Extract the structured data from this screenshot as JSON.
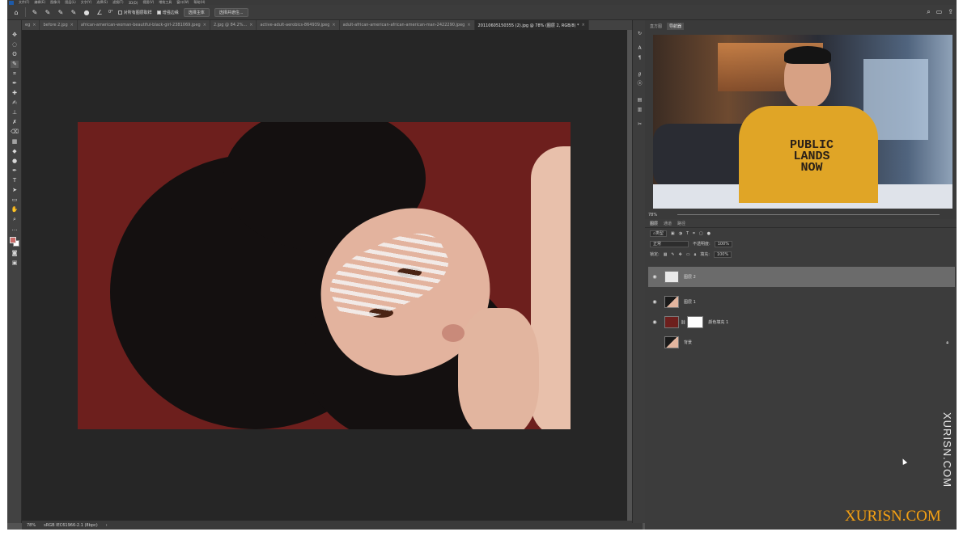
{
  "menubar": {
    "items": [
      "文件(F)",
      "编辑(E)",
      "图像(I)",
      "图层(L)",
      "文字(Y)",
      "选择(S)",
      "滤镜(T)",
      "3D(D)",
      "视图(V)",
      "增效工具",
      "窗口(W)",
      "帮助(H)"
    ]
  },
  "options": {
    "angle": "0°",
    "sample_all_layers": "对所有图层取样",
    "enhance_edge": "增强边缘",
    "select_subject": "选择主体",
    "select_and_mask": "选择并遮住..."
  },
  "tabs": [
    {
      "label": "eg",
      "active": false
    },
    {
      "label": "before 2.jpg",
      "active": false
    },
    {
      "label": "african-american-woman-beautiful-black-girl-2381069.jpeg",
      "active": false
    },
    {
      "label": "2.jpg @ 84.2%...",
      "active": false
    },
    {
      "label": "active-adult-aerobics-864939.jpeg",
      "active": false
    },
    {
      "label": "adult-african-american-african-american-man-2422290.jpeg",
      "active": false
    },
    {
      "label": "20110605150355 (2).jpg @ 78% (图层 2, RGB/8) *",
      "active": true
    }
  ],
  "status": {
    "zoom": "78%",
    "profile": "sRGB IEC61966-2.1 (8bpc)"
  },
  "panel_top": {
    "tabs": [
      "直方图",
      "导航器"
    ],
    "active_tab": "导航器",
    "zoom": "78%"
  },
  "webcam": {
    "shirt_text_1": "PUBLIC",
    "shirt_text_2": "LANDS",
    "shirt_text_3": "NOW"
  },
  "layers_panel": {
    "tabs": [
      "图层",
      "通道",
      "路径"
    ],
    "kind_label": "类型",
    "blend_mode": "正常",
    "opacity_label": "不透明度:",
    "opacity": "100%",
    "lock_label": "锁定:",
    "fill_label": "填充:",
    "fill": "100%",
    "layers": [
      {
        "name": "图层 2",
        "selected": true
      },
      {
        "name": "图层 1",
        "selected": false
      },
      {
        "name": "颜色填充 1",
        "selected": false
      },
      {
        "name": "背景",
        "selected": false
      }
    ]
  },
  "watermark": {
    "vertical": "XURISN.COM",
    "logo": "XURISN.COM"
  },
  "colors": {
    "artwork_background": "#6d1f1d",
    "foreground_swatch": "#c96a67",
    "selected_layer": "#6b6b6b"
  }
}
